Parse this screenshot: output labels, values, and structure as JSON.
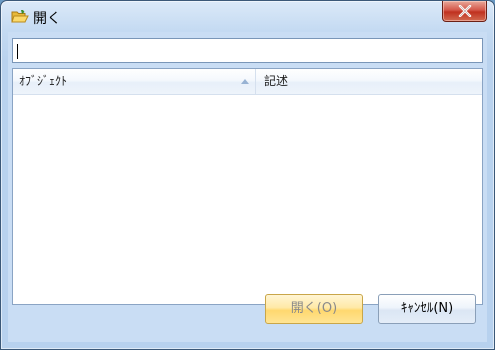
{
  "window": {
    "title": "開く",
    "icon": "folder-open-icon",
    "close_icon": "close-icon"
  },
  "search": {
    "value": "",
    "placeholder": ""
  },
  "list": {
    "columns": [
      {
        "label": "ｵﾌﾞｼﾞｪｸﾄ",
        "sorted": "ascending"
      },
      {
        "label": "記述"
      }
    ],
    "rows": []
  },
  "buttons": {
    "open_label": "開く(O)",
    "cancel_label": "ｷｬﾝｾﾙ(N)"
  },
  "colors": {
    "frame": "#b7d1ee",
    "close": "#c0311f",
    "default_button": "#ffd86f"
  }
}
